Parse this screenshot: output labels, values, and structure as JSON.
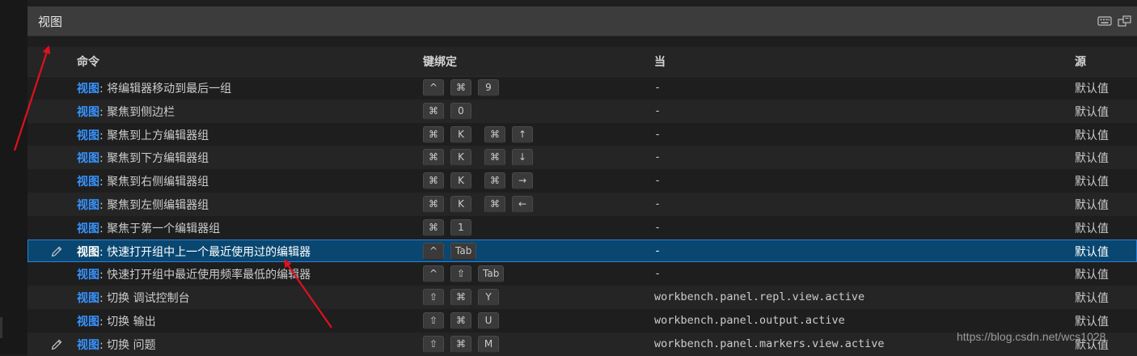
{
  "panel": {
    "title": "视图"
  },
  "icons": {
    "keyboard": "keyboard-icon",
    "split": "open-editor-icon",
    "edit": "pencil-icon"
  },
  "columns": {
    "command": "命令",
    "keybinding": "键绑定",
    "when": "当",
    "source": "源"
  },
  "rows": [
    {
      "category": "视图",
      "label": ": 将编辑器移动到最后一组",
      "keys": [
        "^",
        "⌘",
        "9"
      ],
      "gap_before": [],
      "when": "-",
      "source": "默认值",
      "edit": false
    },
    {
      "category": "视图",
      "label": ": 聚焦到侧边栏",
      "keys": [
        "⌘",
        "0"
      ],
      "gap_before": [],
      "when": "-",
      "source": "默认值",
      "edit": false
    },
    {
      "category": "视图",
      "label": ": 聚焦到上方编辑器组",
      "keys": [
        "⌘",
        "K",
        "⌘",
        "↑"
      ],
      "gap_before": [
        2
      ],
      "when": "-",
      "source": "默认值",
      "edit": false
    },
    {
      "category": "视图",
      "label": ": 聚焦到下方编辑器组",
      "keys": [
        "⌘",
        "K",
        "⌘",
        "↓"
      ],
      "gap_before": [
        2
      ],
      "when": "-",
      "source": "默认值",
      "edit": false
    },
    {
      "category": "视图",
      "label": ": 聚焦到右侧编辑器组",
      "keys": [
        "⌘",
        "K",
        "⌘",
        "→"
      ],
      "gap_before": [
        2
      ],
      "when": "-",
      "source": "默认值",
      "edit": false
    },
    {
      "category": "视图",
      "label": ": 聚焦到左侧编辑器组",
      "keys": [
        "⌘",
        "K",
        "⌘",
        "←"
      ],
      "gap_before": [
        2
      ],
      "when": "-",
      "source": "默认值",
      "edit": false
    },
    {
      "category": "视图",
      "label": ": 聚焦于第一个编辑器组",
      "keys": [
        "⌘",
        "1"
      ],
      "gap_before": [],
      "when": "-",
      "source": "默认值",
      "edit": false
    },
    {
      "category": "视图",
      "label": ": 快速打开组中上一个最近使用过的编辑器",
      "keys": [
        "^",
        "Tab"
      ],
      "gap_before": [],
      "when": "-",
      "source": "默认值",
      "edit": true,
      "selected": true
    },
    {
      "category": "视图",
      "label": ": 快速打开组中最近使用频率最低的编辑器",
      "keys": [
        "^",
        "⇧",
        "Tab"
      ],
      "gap_before": [],
      "when": "-",
      "source": "默认值",
      "edit": false
    },
    {
      "category": "视图",
      "label": ": 切换 调试控制台",
      "keys": [
        "⇧",
        "⌘",
        "Y"
      ],
      "gap_before": [],
      "when": "workbench.panel.repl.view.active",
      "source": "默认值",
      "edit": false
    },
    {
      "category": "视图",
      "label": ": 切换 输出",
      "keys": [
        "⇧",
        "⌘",
        "U"
      ],
      "gap_before": [],
      "when": "workbench.panel.output.active",
      "source": "默认值",
      "edit": false
    },
    {
      "category": "视图",
      "label": ": 切换 问题",
      "keys": [
        "⇧",
        "⌘",
        "M"
      ],
      "gap_before": [],
      "when": "workbench.panel.markers.view.active",
      "source": "默认值",
      "edit": true
    }
  ],
  "watermark": "https://blog.csdn.net/wcs1028",
  "colors": {
    "accent": "#3794ff",
    "selection": "#094771",
    "arrow": "#e0101e"
  }
}
